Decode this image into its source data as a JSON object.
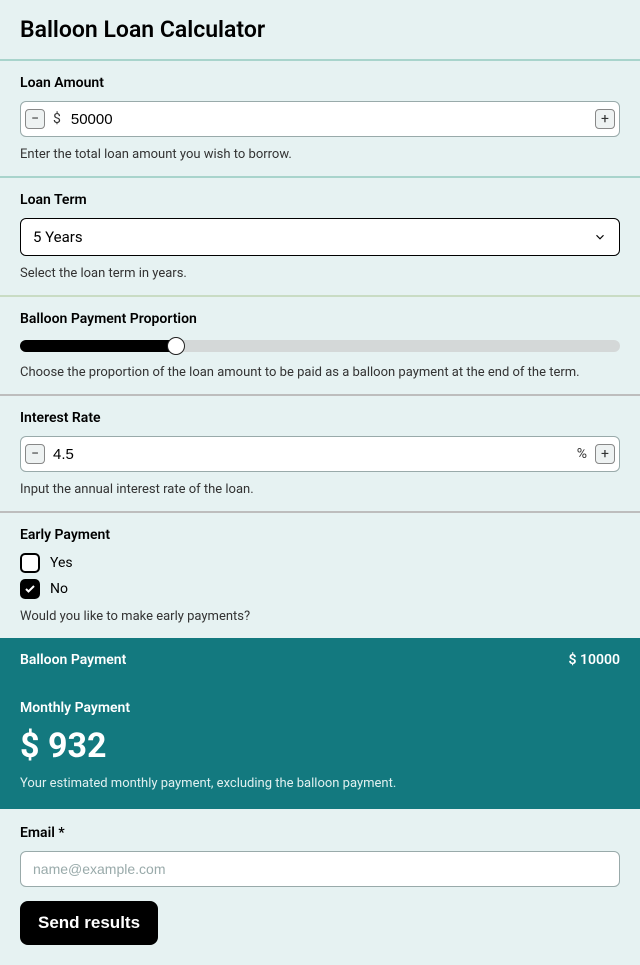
{
  "title": "Balloon Loan Calculator",
  "loanAmount": {
    "label": "Loan Amount",
    "prefix": "$",
    "value": "50000",
    "desc": "Enter the total loan amount you wish to borrow."
  },
  "loanTerm": {
    "label": "Loan Term",
    "value": "5 Years",
    "desc": "Select the loan term in years."
  },
  "balloonProp": {
    "label": "Balloon Payment Proportion",
    "desc": "Choose the proportion of the loan amount to be paid as a balloon payment at the end of the term."
  },
  "interest": {
    "label": "Interest Rate",
    "value": "4.5",
    "suffix": "%",
    "desc": "Input the annual interest rate of the loan."
  },
  "early": {
    "label": "Early Payment",
    "yes": "Yes",
    "no": "No",
    "desc": "Would you like to make early payments?"
  },
  "balloonResult": {
    "label": "Balloon Payment",
    "value": "$ 10000"
  },
  "monthlyResult": {
    "label": "Monthly Payment",
    "value": "$ 932",
    "desc": "Your estimated monthly payment, excluding the balloon payment."
  },
  "email": {
    "label": "Email *",
    "placeholder": "name@example.com"
  },
  "sendLabel": "Send results"
}
